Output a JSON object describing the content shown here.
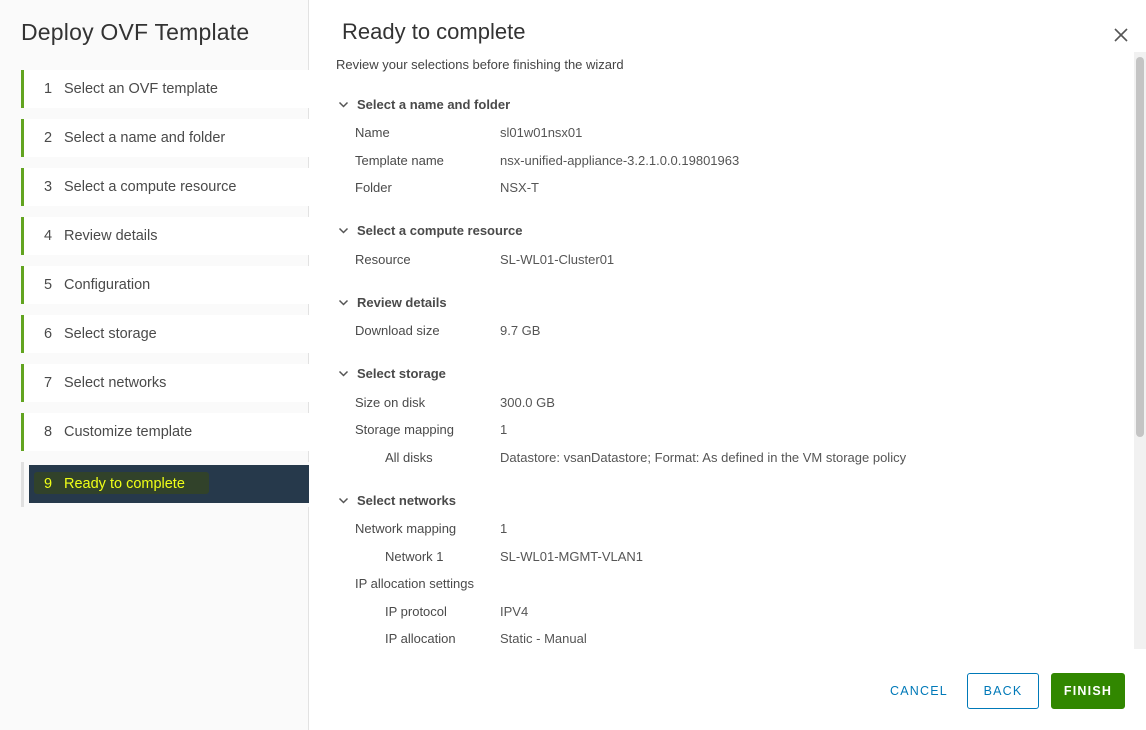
{
  "sidebar": {
    "title": "Deploy OVF Template",
    "steps": [
      {
        "num": "1",
        "label": "Select an OVF template"
      },
      {
        "num": "2",
        "label": "Select a name and folder"
      },
      {
        "num": "3",
        "label": "Select a compute resource"
      },
      {
        "num": "4",
        "label": "Review details"
      },
      {
        "num": "5",
        "label": "Configuration"
      },
      {
        "num": "6",
        "label": "Select storage"
      },
      {
        "num": "7",
        "label": "Select networks"
      },
      {
        "num": "8",
        "label": "Customize template"
      },
      {
        "num": "9",
        "label": "Ready to complete"
      }
    ]
  },
  "main": {
    "title": "Ready to complete",
    "subtitle": "Review your selections before finishing the wizard",
    "sections": [
      {
        "title": "Select a name and folder",
        "rows": [
          {
            "key": "Name",
            "value": "sl01w01nsx01"
          },
          {
            "key": "Template name",
            "value": "nsx-unified-appliance-3.2.1.0.0.19801963"
          },
          {
            "key": "Folder",
            "value": "NSX-T"
          }
        ]
      },
      {
        "title": "Select a compute resource",
        "rows": [
          {
            "key": "Resource",
            "value": "SL-WL01-Cluster01"
          }
        ]
      },
      {
        "title": "Review details",
        "rows": [
          {
            "key": "Download size",
            "value": "9.7 GB"
          }
        ]
      },
      {
        "title": "Select storage",
        "rows": [
          {
            "key": "Size on disk",
            "value": "300.0 GB"
          },
          {
            "key": "Storage mapping",
            "value": "1"
          },
          {
            "key": "All disks",
            "value": "Datastore: vsanDatastore; Format: As defined in the VM storage policy"
          }
        ]
      },
      {
        "title": "Select networks",
        "rows": [
          {
            "key": "Network mapping",
            "value": "1"
          },
          {
            "key": "Network 1",
            "value": "SL-WL01-MGMT-VLAN1"
          },
          {
            "key": "IP allocation settings",
            "value": ""
          },
          {
            "key": "IP protocol",
            "value": "IPV4"
          },
          {
            "key": "IP allocation",
            "value": "Static - Manual"
          }
        ]
      }
    ]
  },
  "footer": {
    "cancel_label": "CANCEL",
    "back_label": "BACK",
    "finish_label": "FINISH"
  },
  "colors": {
    "step_accent": "#62a420",
    "active_bg": "#26394b",
    "active_text": "#f0ff17",
    "link_blue": "#0079b8",
    "finish_green": "#318700"
  },
  "icons": {
    "close": "close-icon",
    "section_toggle": "chevron-down-icon"
  }
}
